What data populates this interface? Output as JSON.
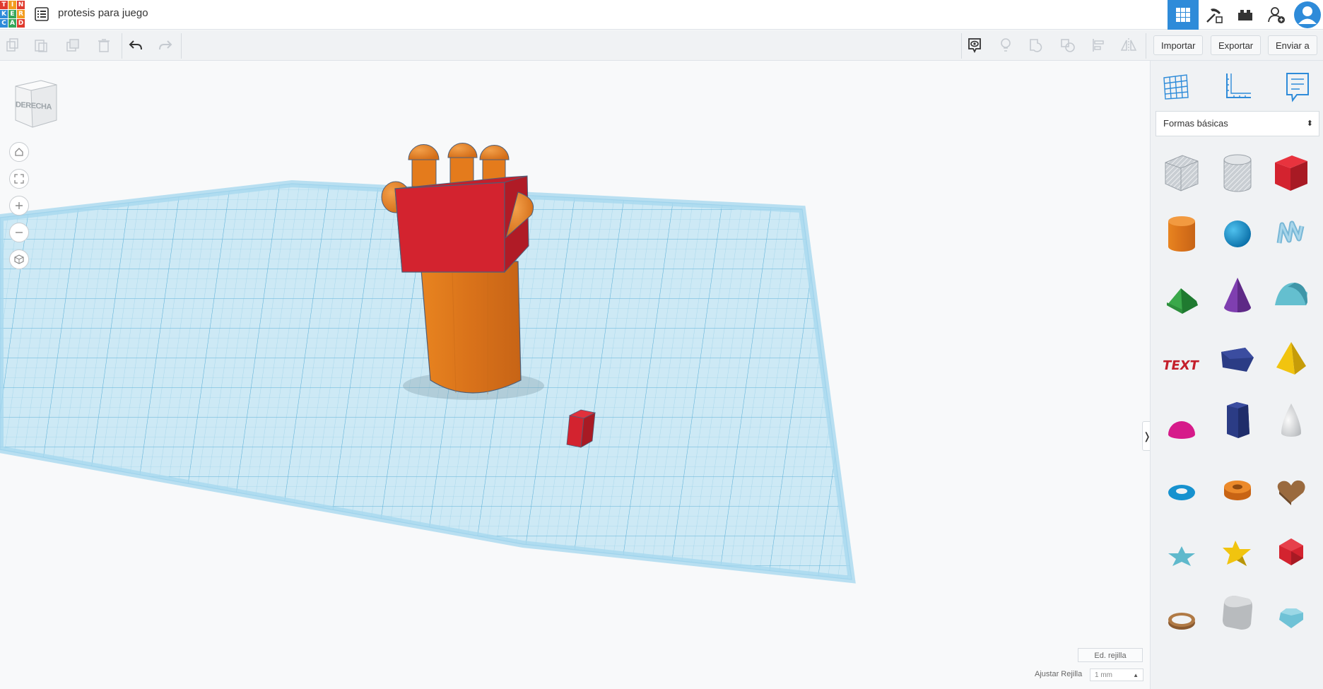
{
  "header": {
    "logo_letters": [
      "T",
      "I",
      "N",
      "K",
      "E",
      "R",
      "C",
      "A",
      "D"
    ],
    "logo_colors": [
      "#e03b2e",
      "#f29c1f",
      "#e03b2e",
      "#2e8bd9",
      "#37a65a",
      "#f29c1f",
      "#2e8bd9",
      "#37a65a",
      "#e03b2e"
    ],
    "title": "protesis para juego",
    "nav_icons": [
      "3d-design-grid-icon",
      "circuits-pickaxe-icon",
      "bricks-icon",
      "invite-user-icon",
      "user-avatar-icon"
    ]
  },
  "toolbar": {
    "buttons_left": [
      "copy-icon",
      "paste-icon",
      "duplicate-icon",
      "trash-icon",
      "undo-icon",
      "redo-icon"
    ],
    "buttons_right": [
      "show-all-icon",
      "light-bulb-icon",
      "group-icon",
      "ungroup-icon",
      "align-icon",
      "mirror-icon"
    ],
    "import_label": "Importar",
    "export_label": "Exportar",
    "send_label": "Enviar a"
  },
  "workspace": {
    "viewcube_label": "DERECHA",
    "controls": [
      "home-view-icon",
      "fit-all-icon",
      "zoom-in-icon",
      "zoom-out-icon",
      "ortho-view-icon"
    ],
    "edit_grid_label": "Ed. rejilla",
    "snap_label": "Ajustar Rejilla",
    "snap_value": "1 mm",
    "collapse_glyph": "❭"
  },
  "panel": {
    "tabs": [
      "workplane-grid-icon",
      "ruler-icon",
      "notes-icon"
    ],
    "category": "Formas básicas",
    "shapes": [
      "box-hole",
      "cylinder-hole",
      "box",
      "cylinder",
      "sphere",
      "scribble",
      "roof",
      "cone",
      "round-roof",
      "text",
      "polygon",
      "pyramid",
      "half-sphere",
      "hexagonal-prism",
      "paraboloid",
      "torus",
      "tube",
      "heart",
      "star",
      "star-yellow",
      "icosahedron",
      "ring",
      "rounded-box",
      "gem"
    ]
  },
  "colors": {
    "accent": "#2e8bd9",
    "workplane": "#bfe3f3",
    "orange": "#e47b1c",
    "red": "#d3232f"
  }
}
